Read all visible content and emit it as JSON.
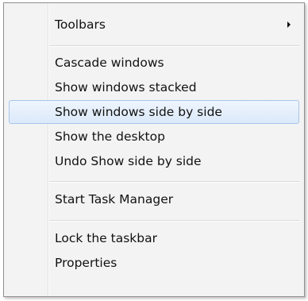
{
  "menu": {
    "items": [
      {
        "label": "Toolbars",
        "has_submenu": true
      },
      {
        "label": "Cascade windows"
      },
      {
        "label": "Show windows stacked"
      },
      {
        "label": "Show windows side by side",
        "highlighted": true
      },
      {
        "label": "Show the desktop"
      },
      {
        "label": "Undo Show side by side"
      },
      {
        "label": "Start Task Manager"
      },
      {
        "label": "Lock the taskbar"
      },
      {
        "label": "Properties"
      }
    ]
  },
  "colors": {
    "menu_background": "#f3f3f3",
    "menu_border": "#8f8f8f",
    "highlight_background": "#dbe9f9",
    "highlight_border": "#a9c6ec",
    "text": "#111111"
  }
}
